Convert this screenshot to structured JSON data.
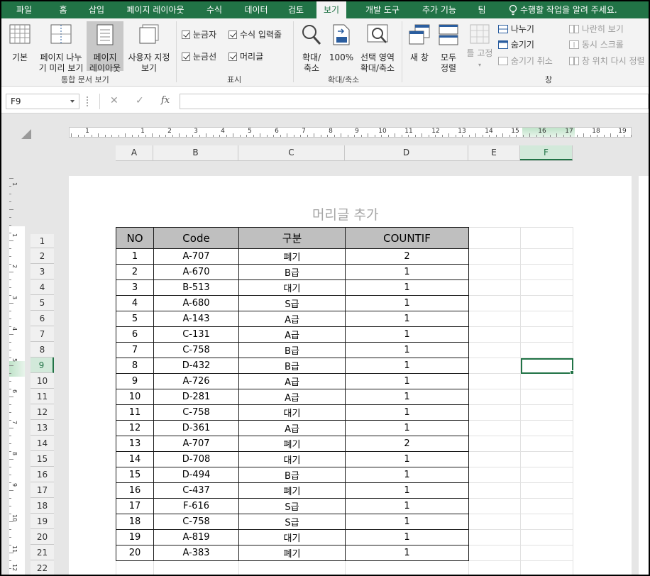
{
  "tabs": [
    "파일",
    "홈",
    "삽입",
    "페이지 레이아웃",
    "수식",
    "데이터",
    "검토",
    "보기",
    "개발 도구",
    "추가 기능",
    "팀"
  ],
  "active_tab": "보기",
  "tell_me": "수행할 작업을 알려 주세요.",
  "ribbon": {
    "views": {
      "normal": "기본",
      "page_break": [
        "페이지 나누",
        "기 미리 보기"
      ],
      "page_layout": [
        "페이지",
        "레이아웃"
      ],
      "custom": [
        "사용자 지정",
        "보기"
      ],
      "group": "통합 문서 보기"
    },
    "show": {
      "ruler": "눈금자",
      "formula_bar": "수식 입력줄",
      "gridlines": "눈금선",
      "headings": "머리글",
      "group": "표시"
    },
    "zoom": {
      "zoom": [
        "확대/",
        "축소"
      ],
      "hundred": "100%",
      "selection": [
        "선택 영역",
        "확대/축소"
      ],
      "group": "확대/축소"
    },
    "window": {
      "new": "새 창",
      "arrange": [
        "모두",
        "정렬"
      ],
      "freeze": "틀 고정",
      "split": "나누기",
      "hide": "숨기기",
      "unhide": "숨기기 취소",
      "side_by_side": "나란히 보기",
      "sync_scroll": "동시 스크롤",
      "reset_pos": "창 위치 다시 정렬",
      "group": "창"
    }
  },
  "name_box": "F9",
  "fx": "fx",
  "columns": [
    "A",
    "B",
    "C",
    "D",
    "E",
    "F"
  ],
  "selected_column": "F",
  "selected_row": "9",
  "header_placeholder": "머리글 추가",
  "ruler_numbers": [
    "1",
    "1",
    "2",
    "3",
    "4",
    "5",
    "6",
    "7",
    "8",
    "9",
    "10",
    "11",
    "12",
    "13",
    "14",
    "15",
    "16",
    "17",
    "18",
    "19"
  ],
  "vruler_numbers": [
    "1",
    "1",
    "2",
    "3",
    "4",
    "5",
    "6",
    "7",
    "8",
    "9",
    "10",
    "11",
    "12"
  ],
  "row_numbers": [
    "1",
    "2",
    "3",
    "4",
    "5",
    "6",
    "7",
    "8",
    "9",
    "10",
    "11",
    "12",
    "13",
    "14",
    "15",
    "16",
    "17",
    "18",
    "19",
    "20",
    "21",
    "22"
  ],
  "table": {
    "headers": [
      "NO",
      "Code",
      "구분",
      "COUNTIF"
    ],
    "rows": [
      [
        "1",
        "A-707",
        "폐기",
        "2"
      ],
      [
        "2",
        "A-670",
        "B급",
        "1"
      ],
      [
        "3",
        "B-513",
        "대기",
        "1"
      ],
      [
        "4",
        "A-680",
        "S급",
        "1"
      ],
      [
        "5",
        "A-143",
        "A급",
        "1"
      ],
      [
        "6",
        "C-131",
        "A급",
        "1"
      ],
      [
        "7",
        "C-758",
        "B급",
        "1"
      ],
      [
        "8",
        "D-432",
        "B급",
        "1"
      ],
      [
        "9",
        "A-726",
        "A급",
        "1"
      ],
      [
        "10",
        "D-281",
        "A급",
        "1"
      ],
      [
        "11",
        "C-758",
        "대기",
        "1"
      ],
      [
        "12",
        "D-361",
        "A급",
        "1"
      ],
      [
        "13",
        "A-707",
        "폐기",
        "2"
      ],
      [
        "14",
        "D-708",
        "대기",
        "1"
      ],
      [
        "15",
        "D-494",
        "B급",
        "1"
      ],
      [
        "16",
        "C-437",
        "폐기",
        "1"
      ],
      [
        "17",
        "F-616",
        "S급",
        "1"
      ],
      [
        "18",
        "C-758",
        "S급",
        "1"
      ],
      [
        "19",
        "A-819",
        "대기",
        "1"
      ],
      [
        "20",
        "A-383",
        "폐기",
        "1"
      ]
    ]
  },
  "colors": {
    "excel_green": "#217346",
    "header_fill": "#bfbfbf"
  }
}
